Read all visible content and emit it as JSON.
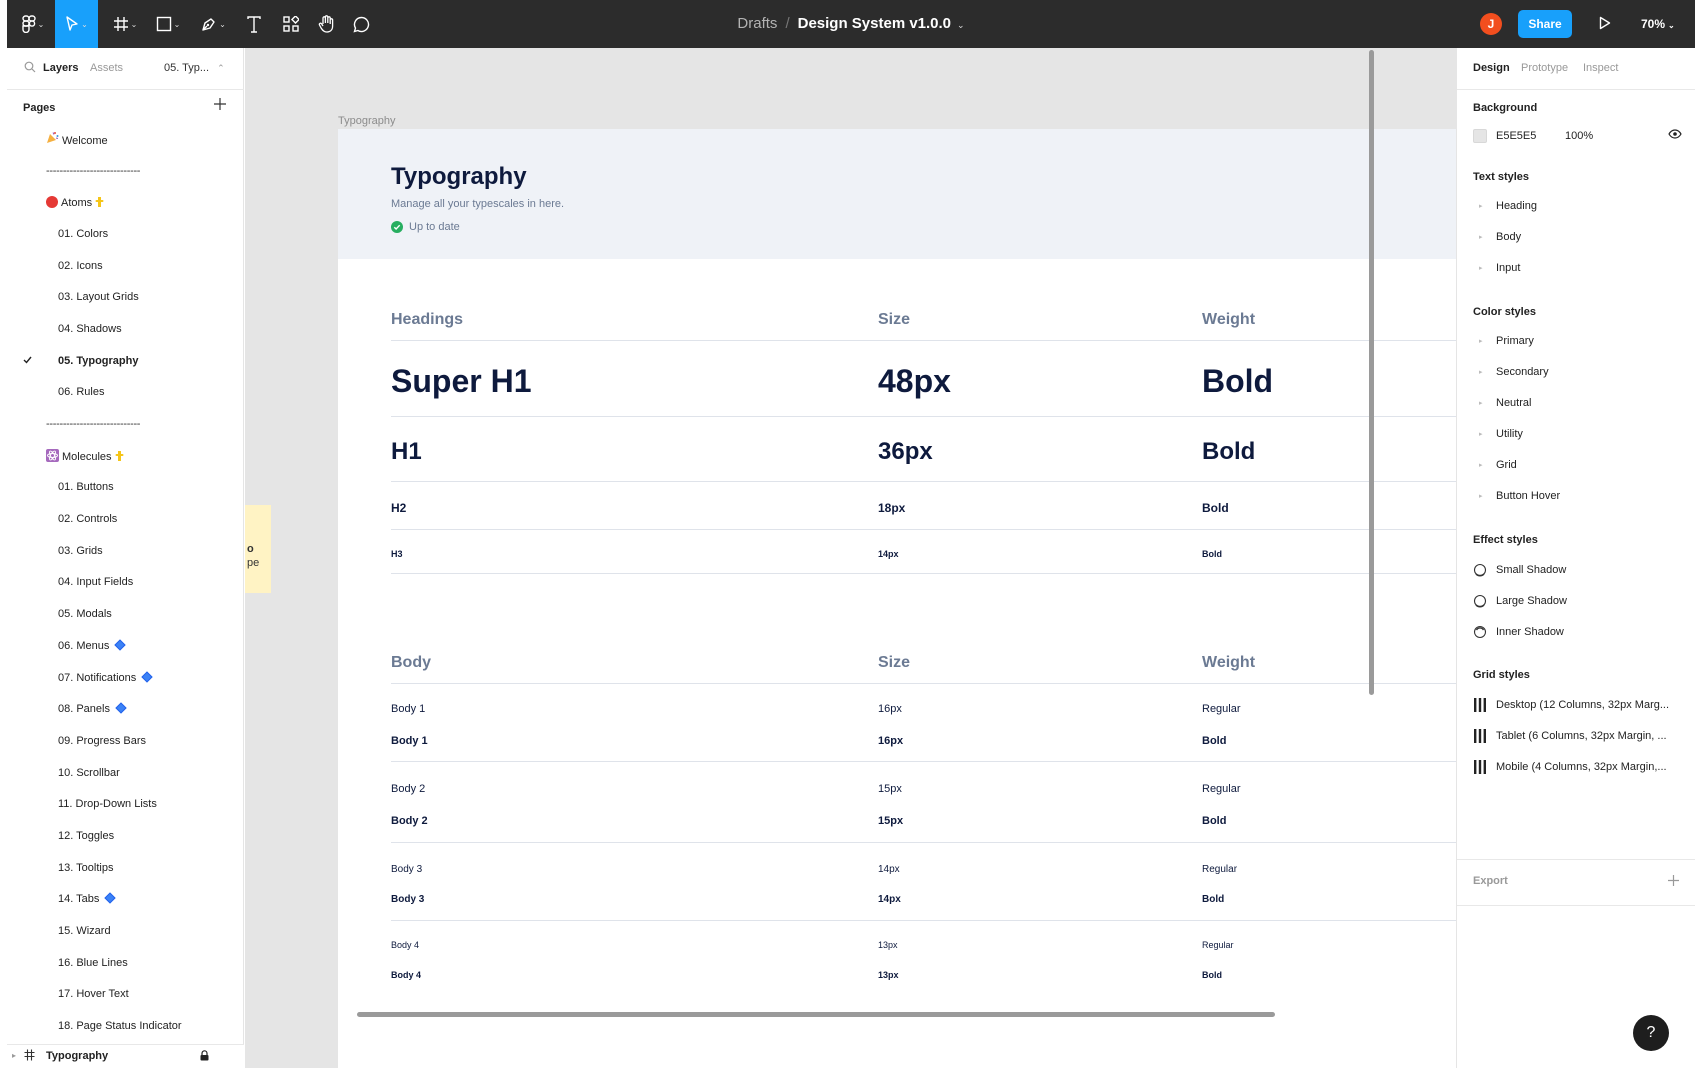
{
  "toolbar": {
    "tools": [
      {
        "name": "main-menu-icon",
        "has_caret": true
      },
      {
        "name": "move-tool-icon",
        "has_caret": true,
        "active": true
      },
      {
        "name": "frame-tool-icon",
        "has_caret": true
      },
      {
        "name": "shape-tool-icon",
        "has_caret": true
      },
      {
        "name": "pen-tool-icon",
        "has_caret": true
      },
      {
        "name": "text-tool-icon",
        "has_caret": false
      },
      {
        "name": "resources-icon",
        "has_caret": false
      },
      {
        "name": "hand-tool-icon",
        "has_caret": false
      },
      {
        "name": "comment-tool-icon",
        "has_caret": false
      }
    ],
    "breadcrumb_parent": "Drafts",
    "breadcrumb_sep": "/",
    "file_name": "Design System v1.0.0",
    "avatar_initial": "J",
    "share_label": "Share",
    "zoom": "70%",
    "active_color": "#18a0fb",
    "avatar_color": "#f24e1e"
  },
  "left_panel": {
    "tabs": {
      "layers": "Layers",
      "assets": "Assets"
    },
    "page_selector": "05. Typ...",
    "pages_heading": "Pages",
    "pages": [
      {
        "label": "Welcome",
        "kind": "page",
        "level": 0,
        "prefix": "party-popper"
      },
      {
        "label": "----------------------------",
        "kind": "divider"
      },
      {
        "label": "Atoms",
        "kind": "page",
        "level": 0,
        "prefix": "red-circle",
        "suffix": "point-down"
      },
      {
        "label": "01.  Colors",
        "kind": "page",
        "level": 1
      },
      {
        "label": "02.  Icons",
        "kind": "page",
        "level": 1
      },
      {
        "label": "03.  Layout Grids",
        "kind": "page",
        "level": 1
      },
      {
        "label": "04.  Shadows",
        "kind": "page",
        "level": 1
      },
      {
        "label": "05.  Typography",
        "kind": "page",
        "level": 1,
        "selected": true
      },
      {
        "label": "06.  Rules",
        "kind": "page",
        "level": 1
      },
      {
        "label": "----------------------------",
        "kind": "divider"
      },
      {
        "label": "Molecules",
        "kind": "page",
        "level": 0,
        "prefix": "atom-symbol",
        "suffix": "point-down"
      },
      {
        "label": "01.  Buttons",
        "kind": "page",
        "level": 1
      },
      {
        "label": "02.  Controls",
        "kind": "page",
        "level": 1
      },
      {
        "label": "03.  Grids",
        "kind": "page",
        "level": 1
      },
      {
        "label": "04.  Input Fields",
        "kind": "page",
        "level": 1
      },
      {
        "label": "05.  Modals",
        "kind": "page",
        "level": 1
      },
      {
        "label": "06.  Menus",
        "kind": "page",
        "level": 1,
        "suffix": "blue-diamond"
      },
      {
        "label": "07.  Notifications",
        "kind": "page",
        "level": 1,
        "suffix": "blue-diamond"
      },
      {
        "label": "08.  Panels",
        "kind": "page",
        "level": 1,
        "suffix": "blue-diamond"
      },
      {
        "label": "09.  Progress Bars",
        "kind": "page",
        "level": 1
      },
      {
        "label": "10.  Scrollbar",
        "kind": "page",
        "level": 1
      },
      {
        "label": "11.  Drop-Down Lists",
        "kind": "page",
        "level": 1
      },
      {
        "label": "12.  Toggles",
        "kind": "page",
        "level": 1
      },
      {
        "label": "13.  Tooltips",
        "kind": "page",
        "level": 1
      },
      {
        "label": "14.  Tabs",
        "kind": "page",
        "level": 1,
        "suffix": "blue-diamond"
      },
      {
        "label": "15.  Wizard",
        "kind": "page",
        "level": 1
      },
      {
        "label": "16.  Blue Lines",
        "kind": "page",
        "level": 1
      },
      {
        "label": "17.  Hover Text",
        "kind": "page",
        "level": 1
      },
      {
        "label": "18.  Page Status Indicator",
        "kind": "page",
        "level": 1
      }
    ],
    "footer_layer": "Typography"
  },
  "canvas": {
    "sticky_lines": [
      "o",
      "pe"
    ],
    "frame_label": "Typography",
    "header": {
      "title": "Typography",
      "subtitle": "Manage all your typescales in here.",
      "status": "Up to date",
      "status_color": "#27ae60"
    },
    "headings_table": {
      "columns": [
        "Headings",
        "Size",
        "Weight"
      ],
      "rows": [
        {
          "name": "Super H1",
          "size": "48px",
          "weight": "Bold"
        },
        {
          "name": "H1",
          "size": "36px",
          "weight": "Bold"
        },
        {
          "name": "H2",
          "size": "18px",
          "weight": "Bold"
        },
        {
          "name": "H3",
          "size": "14px",
          "weight": "Bold"
        }
      ]
    },
    "body_table": {
      "columns": [
        "Body",
        "Size",
        "Weight"
      ],
      "groups": [
        {
          "rows": [
            {
              "name": "Body 1",
              "size": "16px",
              "weight": "Regular"
            },
            {
              "name": "Body 1",
              "size": "16px",
              "weight": "Bold"
            }
          ]
        },
        {
          "rows": [
            {
              "name": "Body 2",
              "size": "15px",
              "weight": "Regular"
            },
            {
              "name": "Body 2",
              "size": "15px",
              "weight": "Bold"
            }
          ]
        },
        {
          "rows": [
            {
              "name": "Body 3",
              "size": "14px",
              "weight": "Regular"
            },
            {
              "name": "Body 3",
              "size": "14px",
              "weight": "Bold"
            }
          ]
        },
        {
          "rows": [
            {
              "name": "Body 4",
              "size": "13px",
              "weight": "Regular"
            },
            {
              "name": "Body 4",
              "size": "13px",
              "weight": "Bold"
            }
          ]
        }
      ]
    }
  },
  "right_panel": {
    "tabs": {
      "design": "Design",
      "prototype": "Prototype",
      "inspect": "Inspect"
    },
    "background": {
      "heading": "Background",
      "hex": "E5E5E5",
      "opacity": "100%",
      "color": "#e5e5e5"
    },
    "text_styles": {
      "heading": "Text styles",
      "items": [
        "Heading",
        "Body",
        "Input"
      ]
    },
    "color_styles": {
      "heading": "Color styles",
      "items": [
        "Primary",
        "Secondary",
        "Neutral",
        "Utility",
        "Grid",
        "Button Hover"
      ]
    },
    "effect_styles": {
      "heading": "Effect styles",
      "items": [
        "Small Shadow",
        "Large Shadow",
        "Inner Shadow"
      ]
    },
    "grid_styles": {
      "heading": "Grid styles",
      "items": [
        "Desktop (12 Columns, 32px Marg...",
        "Tablet (6 Columns, 32px Margin, ...",
        "Mobile (4 Columns, 32px Margin,..."
      ]
    },
    "export_label": "Export",
    "help_label": "?"
  }
}
